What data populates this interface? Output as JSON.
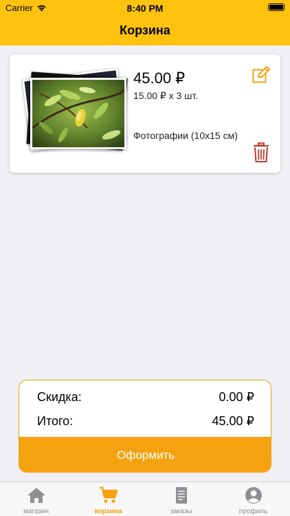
{
  "status_bar": {
    "carrier": "Carrier",
    "time": "8:40 PM"
  },
  "header": {
    "title": "Корзина"
  },
  "cart_item": {
    "price": "45.00 ₽",
    "quantity_line": "15.00 ₽ x 3 шт.",
    "product_name": "Фотографии (10x15 см)"
  },
  "summary": {
    "discount_label": "Скидка:",
    "discount_value": "0.00 ₽",
    "total_label": "Итого:",
    "total_value": "45.00 ₽",
    "checkout_label": "Оформить"
  },
  "tabs": [
    {
      "label": "магазин",
      "icon": "home-icon",
      "active": false
    },
    {
      "label": "корзина",
      "icon": "cart-icon",
      "active": true
    },
    {
      "label": "заказы",
      "icon": "orders-icon",
      "active": false
    },
    {
      "label": "профиль",
      "icon": "profile-icon",
      "active": false
    }
  ],
  "colors": {
    "header_yellow": "#ffc20e",
    "accent_orange": "#f4a20f",
    "trash_red": "#c0392b",
    "inactive_gray": "#8e8e93"
  }
}
